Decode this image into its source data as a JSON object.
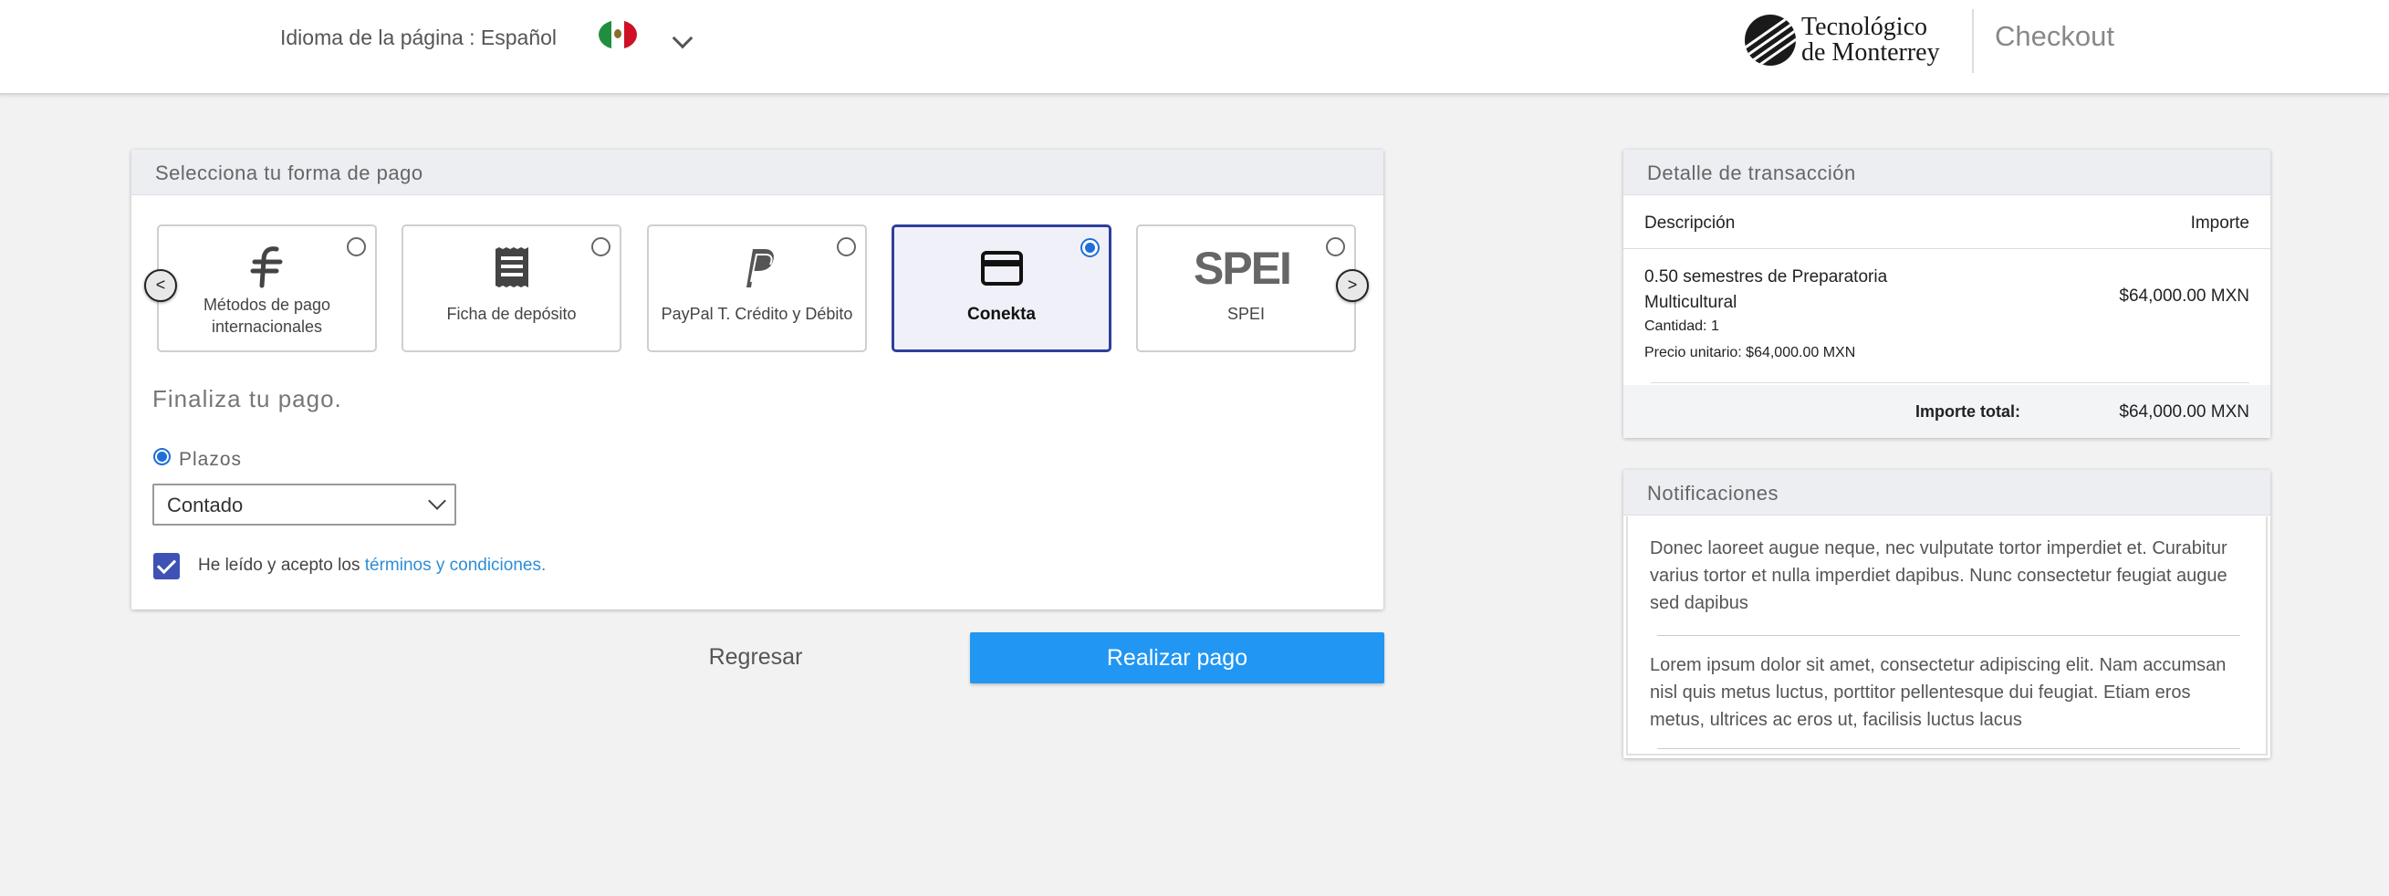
{
  "header": {
    "language_label": "Idioma de la página : Español",
    "logo_text_line1": "Tecnológico",
    "logo_text_line2": "de Monterrey",
    "title": "Checkout"
  },
  "payment": {
    "section_title": "Selecciona tu forma de pago",
    "prev_label": "<",
    "next_label": ">",
    "options": [
      {
        "label": "Métodos de pago internacionales",
        "icon": "flywire-icon",
        "selected": false
      },
      {
        "label": "Ficha de depósito",
        "icon": "receipt-icon",
        "selected": false
      },
      {
        "label": "PayPal T. Crédito y Débito",
        "icon": "paypal-icon",
        "selected": false
      },
      {
        "label": "Conekta",
        "icon": "credit-card-icon",
        "selected": true
      },
      {
        "label": "SPEI",
        "icon": "spei-logo",
        "selected": false
      }
    ],
    "finaliza": "Finaliza tu pago.",
    "plazos_label": "Plazos",
    "plazos_value": "Contado",
    "terms_text": "He leído y acepto los ",
    "terms_link": "términos y condiciones.",
    "back_button": "Regresar",
    "pay_button": "Realizar pago"
  },
  "transaction": {
    "title": "Detalle de transacción",
    "col_description": "Descripción",
    "col_amount": "Importe",
    "item_description": "0.50 semestres de Preparatoria Multicultural",
    "item_quantity": "Cantidad: 1",
    "item_unit_price": "Precio unitario: $64,000.00 MXN",
    "item_amount": "$64,000.00 MXN",
    "total_label": "Importe total:",
    "total_value": "$64,000.00 MXN"
  },
  "notifications": {
    "title": "Notificaciones",
    "items": [
      "Donec laoreet augue neque, nec vulputate tortor imperdiet et. Curabitur varius tortor et nulla imperdiet dapibus. Nunc consectetur feugiat augue sed dapibus",
      "Lorem ipsum dolor sit amet, consectetur adipiscing elit. Nam accumsan nisl quis metus luctus, porttitor pellentesque dui feugiat. Etiam eros metus, ultrices ac eros ut, facilisis luctus lacus"
    ]
  },
  "colors": {
    "accent": "#2196f3",
    "selected_border": "#2f3f9e",
    "checkbox": "#3f51b5",
    "link": "#2e8dd6"
  }
}
